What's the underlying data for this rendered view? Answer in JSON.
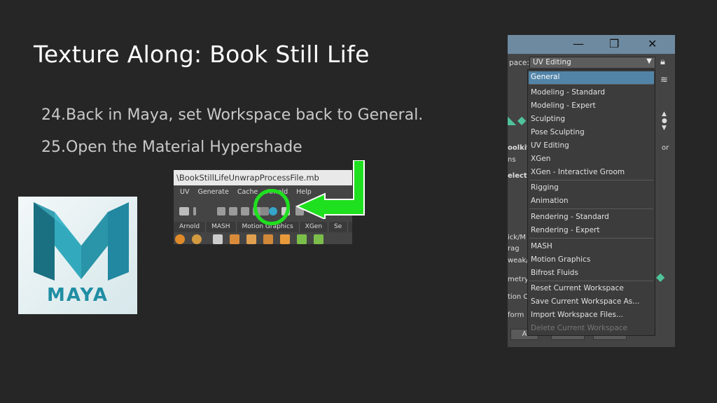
{
  "slide": {
    "title": "Texture Along: Book Still Life",
    "steps": [
      "24.Back in Maya, set Workspace back to General.",
      "25.Open the Material Hypershade"
    ]
  },
  "logo": {
    "text": "MAYA"
  },
  "maya_crop": {
    "file_title": "\\BookStillLifeUnwrapProcessFile.mb",
    "menus": [
      "UV",
      "Generate",
      "Cache",
      "Arnold",
      "Help"
    ],
    "shelf_tabs": [
      "Arnold",
      "MASH",
      "Motion Graphics",
      "XGen",
      "Se"
    ]
  },
  "workspace_window": {
    "title_buttons": [
      "—",
      "❐",
      "✕"
    ],
    "label": "pace:",
    "current_value": "UV Editing",
    "side_labels": [
      "oolkit",
      "ns",
      "electi",
      "ick/M",
      "rag",
      "weak/",
      "metry:",
      "tion C",
      "form"
    ],
    "side_right_labels": [
      "or"
    ],
    "bottom_buttons": [
      "A",
      "",
      ""
    ],
    "menu": [
      {
        "label": "General",
        "selected": true,
        "disabled": false
      },
      {
        "label": "Modeling - Standard",
        "selected": false,
        "disabled": false
      },
      {
        "label": "Modeling - Expert",
        "selected": false,
        "disabled": false
      },
      {
        "label": "Sculpting",
        "selected": false,
        "disabled": false
      },
      {
        "label": "Pose Sculpting",
        "selected": false,
        "disabled": false
      },
      {
        "label": "UV Editing",
        "selected": false,
        "disabled": false
      },
      {
        "label": "XGen",
        "selected": false,
        "disabled": false
      },
      {
        "label": "XGen - Interactive Groom",
        "selected": false,
        "disabled": false
      },
      {
        "label": "Rigging",
        "selected": false,
        "disabled": false
      },
      {
        "label": "Animation",
        "selected": false,
        "disabled": false
      },
      {
        "label": "Rendering - Standard",
        "selected": false,
        "disabled": false
      },
      {
        "label": "Rendering - Expert",
        "selected": false,
        "disabled": false
      },
      {
        "label": "MASH",
        "selected": false,
        "disabled": false
      },
      {
        "label": "Motion Graphics",
        "selected": false,
        "disabled": false
      },
      {
        "label": "Bifrost Fluids",
        "selected": false,
        "disabled": false
      },
      {
        "label": "Reset Current Workspace",
        "selected": false,
        "disabled": false
      },
      {
        "label": "Save Current Workspace As...",
        "selected": false,
        "disabled": false
      },
      {
        "label": "Import Workspace Files...",
        "selected": false,
        "disabled": false
      },
      {
        "label": "Delete Current Workspace",
        "selected": false,
        "disabled": true
      }
    ]
  },
  "colors": {
    "background": "#262626",
    "highlight_green": "#1fe01f",
    "menu_selected": "#5284a8",
    "logo_teal": "#1f8ea3"
  }
}
